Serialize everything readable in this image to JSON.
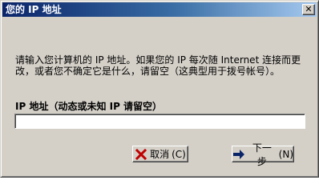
{
  "window": {
    "title": "您的 IP 地址",
    "close_symbol": "✕"
  },
  "content": {
    "description": "请输入您计算机的 IP 地址。如果您的 IP 每次随 Internet 连接而更改，或者您不确定它是什么，请留空（这典型用于拨号帐号）。",
    "field_label": "IP 地址（动态或未知 IP 请留空）",
    "ip_value": ""
  },
  "buttons": {
    "cancel_label": "取消",
    "cancel_accel": "(C)",
    "next_label": "下一步",
    "next_accel": "(N)"
  },
  "icons": {
    "cancel_icon": "red-x-icon",
    "next_icon": "right-arrow-icon"
  },
  "colors": {
    "title_start": "#0a246a",
    "title_end": "#a6caf0",
    "cancel_icon": "#c00000",
    "next_icon": "#0a246a"
  }
}
